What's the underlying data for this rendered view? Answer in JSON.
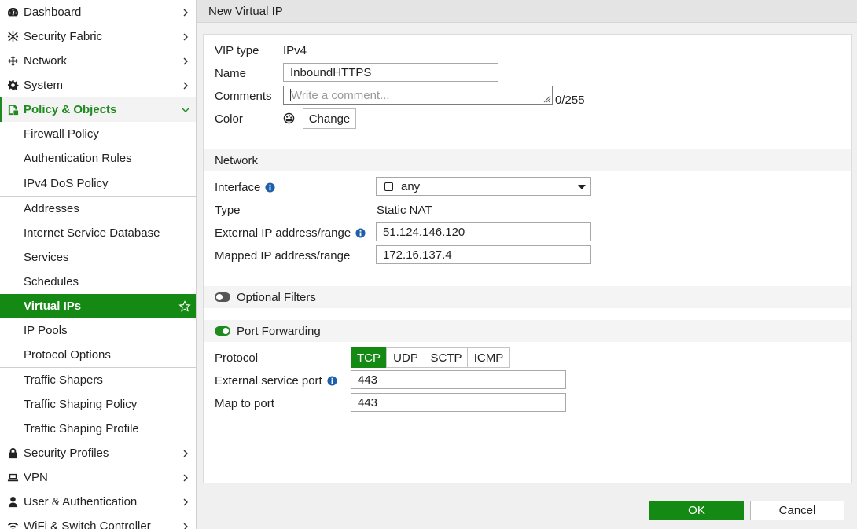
{
  "sidebar": {
    "items": [
      {
        "label": "Dashboard",
        "icon": "dashboard-icon"
      },
      {
        "label": "Security Fabric",
        "icon": "security-fabric-icon"
      },
      {
        "label": "Network",
        "icon": "network-icon"
      },
      {
        "label": "System",
        "icon": "gear-icon"
      },
      {
        "label": "Policy & Objects",
        "icon": "policy-icon"
      }
    ],
    "subitems": [
      "Firewall Policy",
      "Authentication Rules",
      "IPv4 DoS Policy",
      "Addresses",
      "Internet Service Database",
      "Services",
      "Schedules",
      "Virtual IPs",
      "IP Pools",
      "Protocol Options",
      "Traffic Shapers",
      "Traffic Shaping Policy",
      "Traffic Shaping Profile"
    ],
    "bottom_items": [
      {
        "label": "Security Profiles",
        "icon": "lock-icon"
      },
      {
        "label": "VPN",
        "icon": "laptop-icon"
      },
      {
        "label": "User & Authentication",
        "icon": "user-icon"
      },
      {
        "label": "WiFi & Switch Controller",
        "icon": "wifi-icon"
      }
    ]
  },
  "header": {
    "title": "New Virtual IP"
  },
  "form": {
    "vip_type_label": "VIP type",
    "vip_type_value": "IPv4",
    "name_label": "Name",
    "name_value": "InboundHTTPS",
    "comments_label": "Comments",
    "comments_placeholder": "Write a comment...",
    "comments_counter": "0/255",
    "color_label": "Color",
    "color_change": "Change"
  },
  "network": {
    "header": "Network",
    "interface_label": "Interface",
    "interface_value": "any",
    "type_label": "Type",
    "type_value": "Static NAT",
    "external_ip_label": "External IP address/range",
    "external_ip_value": "51.124.146.120",
    "mapped_ip_label": "Mapped IP address/range",
    "mapped_ip_value": "172.16.137.4"
  },
  "optional_filters": {
    "label": "Optional Filters",
    "enabled": false
  },
  "port_forwarding": {
    "label": "Port Forwarding",
    "enabled": true,
    "protocol_label": "Protocol",
    "protocols": [
      "TCP",
      "UDP",
      "SCTP",
      "ICMP"
    ],
    "selected_protocol": "TCP",
    "external_port_label": "External service port",
    "external_port_value": "443",
    "map_port_label": "Map to port",
    "map_port_value": "443"
  },
  "footer": {
    "ok": "OK",
    "cancel": "Cancel"
  },
  "colors": {
    "accent": "#148a14"
  }
}
